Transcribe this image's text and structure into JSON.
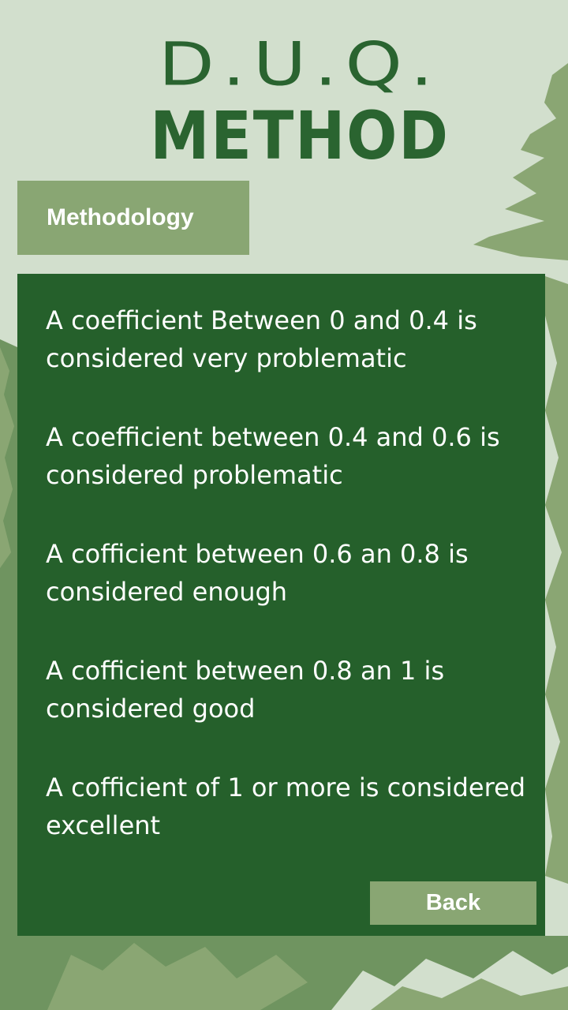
{
  "header": {
    "title_line1": "D.U.Q.",
    "title_line2": "METHOD"
  },
  "tab": {
    "label": "Methodology"
  },
  "content": {
    "items": [
      "A coefficient Between 0 and 0.4 is considered very problematic",
      "A coefficient between 0.4 and 0.6 is considered problematic",
      "A cofficient between 0.6 an 0.8 is considered enough",
      "A cofficient between 0.8 an 1 is considered good",
      "A cofficient of 1 or more is considered excellent"
    ]
  },
  "actions": {
    "back_label": "Back"
  },
  "colors": {
    "background": "#d2dfcd",
    "accent_dark": "#25602b",
    "accent_light": "#89a673",
    "title": "#2a6430"
  }
}
